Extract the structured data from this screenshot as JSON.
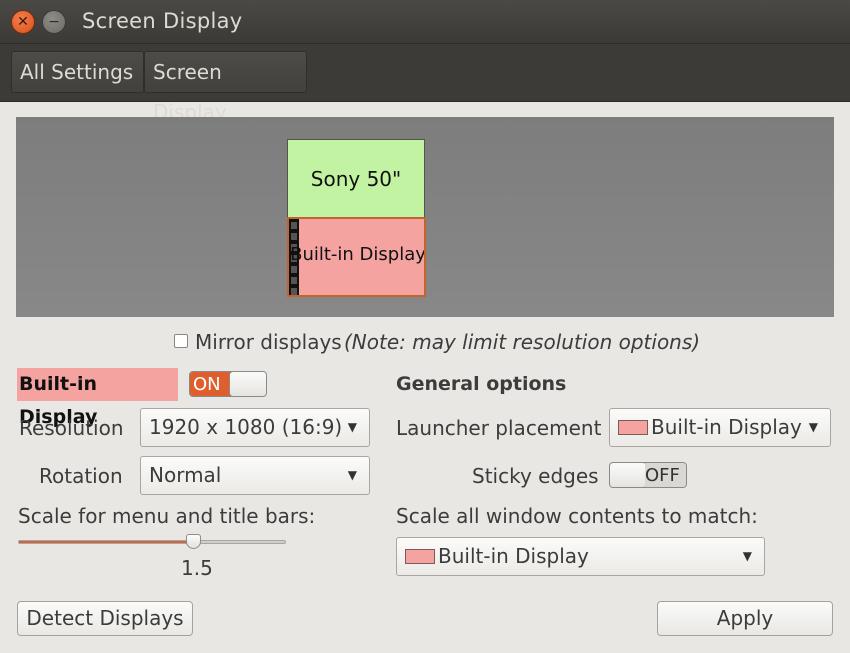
{
  "window": {
    "title": "Screen Display"
  },
  "toolbar": {
    "all_settings": "All Settings",
    "screen_display": "Screen Display"
  },
  "preview": {
    "sony_label": "Sony 50\"",
    "builtin_label": "Built-in Display",
    "sony_color": "#c2f3a2",
    "builtin_color": "#f4a3a1"
  },
  "mirror": {
    "label": "Mirror displays",
    "note": "(Note: may limit resolution options)",
    "checked": false
  },
  "display": {
    "name": "Built-in Display",
    "toggle_label": "ON",
    "resolution_label": "Resolution",
    "resolution_value": "1920 x 1080 (16:9)",
    "rotation_label": "Rotation",
    "rotation_value": "Normal",
    "scale_label": "Scale for menu and title bars:",
    "scale_value": "1.5",
    "scale_fraction": 0.66
  },
  "general": {
    "heading": "General options",
    "launcher_label": "Launcher placement",
    "launcher_value": "Built-in Display",
    "sticky_label": "Sticky edges",
    "sticky_toggle": "OFF",
    "scale_all_label": "Scale all window contents to match:",
    "scale_all_value": "Built-in Display"
  },
  "buttons": {
    "detect": "Detect Displays",
    "apply": "Apply"
  },
  "colors": {
    "accent": "#de5e2d",
    "titlebar": "#3c3b37"
  }
}
